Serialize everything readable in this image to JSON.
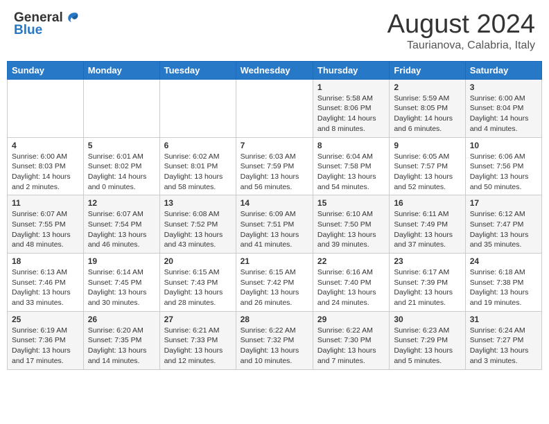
{
  "header": {
    "logo_general": "General",
    "logo_blue": "Blue",
    "month_year": "August 2024",
    "location": "Taurianova, Calabria, Italy"
  },
  "calendar": {
    "days_of_week": [
      "Sunday",
      "Monday",
      "Tuesday",
      "Wednesday",
      "Thursday",
      "Friday",
      "Saturday"
    ],
    "weeks": [
      {
        "days": [
          {
            "number": "",
            "info": ""
          },
          {
            "number": "",
            "info": ""
          },
          {
            "number": "",
            "info": ""
          },
          {
            "number": "",
            "info": ""
          },
          {
            "number": "1",
            "info": "Sunrise: 5:58 AM\nSunset: 8:06 PM\nDaylight: 14 hours\nand 8 minutes."
          },
          {
            "number": "2",
            "info": "Sunrise: 5:59 AM\nSunset: 8:05 PM\nDaylight: 14 hours\nand 6 minutes."
          },
          {
            "number": "3",
            "info": "Sunrise: 6:00 AM\nSunset: 8:04 PM\nDaylight: 14 hours\nand 4 minutes."
          }
        ]
      },
      {
        "days": [
          {
            "number": "4",
            "info": "Sunrise: 6:00 AM\nSunset: 8:03 PM\nDaylight: 14 hours\nand 2 minutes."
          },
          {
            "number": "5",
            "info": "Sunrise: 6:01 AM\nSunset: 8:02 PM\nDaylight: 14 hours\nand 0 minutes."
          },
          {
            "number": "6",
            "info": "Sunrise: 6:02 AM\nSunset: 8:01 PM\nDaylight: 13 hours\nand 58 minutes."
          },
          {
            "number": "7",
            "info": "Sunrise: 6:03 AM\nSunset: 7:59 PM\nDaylight: 13 hours\nand 56 minutes."
          },
          {
            "number": "8",
            "info": "Sunrise: 6:04 AM\nSunset: 7:58 PM\nDaylight: 13 hours\nand 54 minutes."
          },
          {
            "number": "9",
            "info": "Sunrise: 6:05 AM\nSunset: 7:57 PM\nDaylight: 13 hours\nand 52 minutes."
          },
          {
            "number": "10",
            "info": "Sunrise: 6:06 AM\nSunset: 7:56 PM\nDaylight: 13 hours\nand 50 minutes."
          }
        ]
      },
      {
        "days": [
          {
            "number": "11",
            "info": "Sunrise: 6:07 AM\nSunset: 7:55 PM\nDaylight: 13 hours\nand 48 minutes."
          },
          {
            "number": "12",
            "info": "Sunrise: 6:07 AM\nSunset: 7:54 PM\nDaylight: 13 hours\nand 46 minutes."
          },
          {
            "number": "13",
            "info": "Sunrise: 6:08 AM\nSunset: 7:52 PM\nDaylight: 13 hours\nand 43 minutes."
          },
          {
            "number": "14",
            "info": "Sunrise: 6:09 AM\nSunset: 7:51 PM\nDaylight: 13 hours\nand 41 minutes."
          },
          {
            "number": "15",
            "info": "Sunrise: 6:10 AM\nSunset: 7:50 PM\nDaylight: 13 hours\nand 39 minutes."
          },
          {
            "number": "16",
            "info": "Sunrise: 6:11 AM\nSunset: 7:49 PM\nDaylight: 13 hours\nand 37 minutes."
          },
          {
            "number": "17",
            "info": "Sunrise: 6:12 AM\nSunset: 7:47 PM\nDaylight: 13 hours\nand 35 minutes."
          }
        ]
      },
      {
        "days": [
          {
            "number": "18",
            "info": "Sunrise: 6:13 AM\nSunset: 7:46 PM\nDaylight: 13 hours\nand 33 minutes."
          },
          {
            "number": "19",
            "info": "Sunrise: 6:14 AM\nSunset: 7:45 PM\nDaylight: 13 hours\nand 30 minutes."
          },
          {
            "number": "20",
            "info": "Sunrise: 6:15 AM\nSunset: 7:43 PM\nDaylight: 13 hours\nand 28 minutes."
          },
          {
            "number": "21",
            "info": "Sunrise: 6:15 AM\nSunset: 7:42 PM\nDaylight: 13 hours\nand 26 minutes."
          },
          {
            "number": "22",
            "info": "Sunrise: 6:16 AM\nSunset: 7:40 PM\nDaylight: 13 hours\nand 24 minutes."
          },
          {
            "number": "23",
            "info": "Sunrise: 6:17 AM\nSunset: 7:39 PM\nDaylight: 13 hours\nand 21 minutes."
          },
          {
            "number": "24",
            "info": "Sunrise: 6:18 AM\nSunset: 7:38 PM\nDaylight: 13 hours\nand 19 minutes."
          }
        ]
      },
      {
        "days": [
          {
            "number": "25",
            "info": "Sunrise: 6:19 AM\nSunset: 7:36 PM\nDaylight: 13 hours\nand 17 minutes."
          },
          {
            "number": "26",
            "info": "Sunrise: 6:20 AM\nSunset: 7:35 PM\nDaylight: 13 hours\nand 14 minutes."
          },
          {
            "number": "27",
            "info": "Sunrise: 6:21 AM\nSunset: 7:33 PM\nDaylight: 13 hours\nand 12 minutes."
          },
          {
            "number": "28",
            "info": "Sunrise: 6:22 AM\nSunset: 7:32 PM\nDaylight: 13 hours\nand 10 minutes."
          },
          {
            "number": "29",
            "info": "Sunrise: 6:22 AM\nSunset: 7:30 PM\nDaylight: 13 hours\nand 7 minutes."
          },
          {
            "number": "30",
            "info": "Sunrise: 6:23 AM\nSunset: 7:29 PM\nDaylight: 13 hours\nand 5 minutes."
          },
          {
            "number": "31",
            "info": "Sunrise: 6:24 AM\nSunset: 7:27 PM\nDaylight: 13 hours\nand 3 minutes."
          }
        ]
      }
    ]
  }
}
